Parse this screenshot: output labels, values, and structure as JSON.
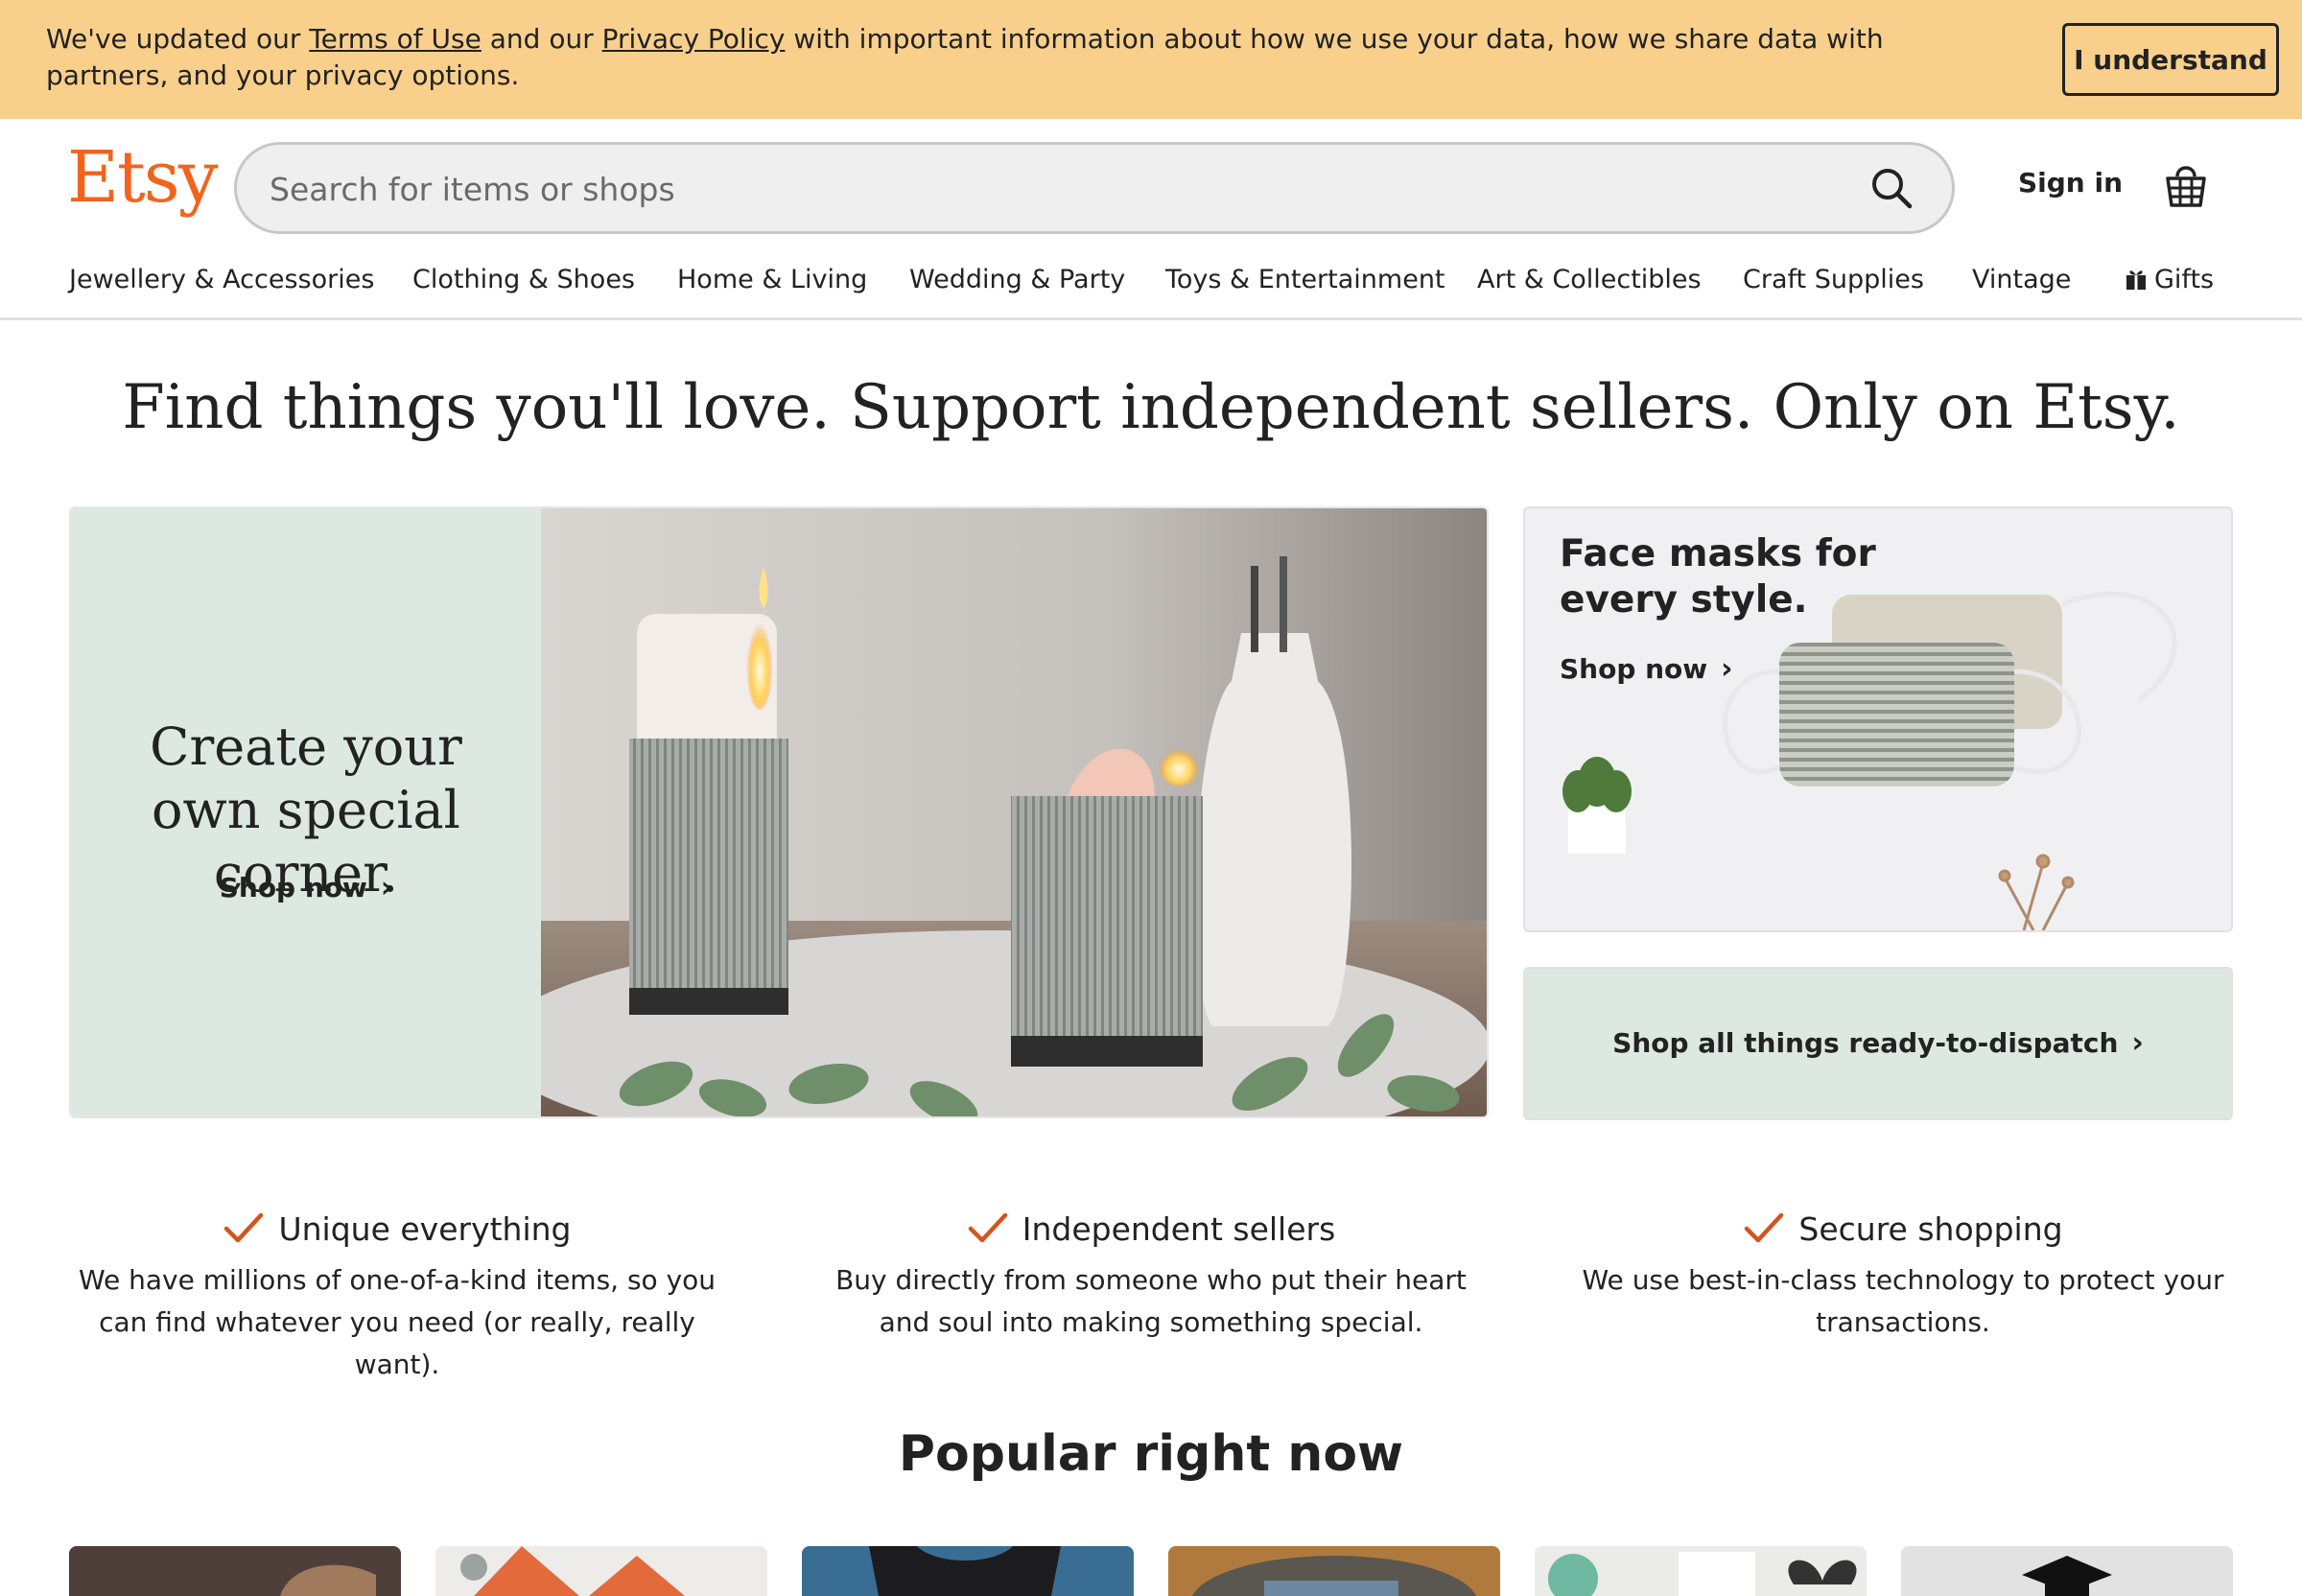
{
  "banner": {
    "text_before": "We've updated our ",
    "terms_link": "Terms of Use",
    "text_middle": " and our ",
    "privacy_link": "Privacy Policy",
    "text_after": " with important information about how we use your data, how we share data with partners, and your privacy options.",
    "button_label": "I understand"
  },
  "header": {
    "logo": "Etsy",
    "search_placeholder": "Search for items or shops",
    "sign_in": "Sign in",
    "icons": [
      "search-icon",
      "shopping-basket-icon"
    ]
  },
  "nav": {
    "items": [
      "Jewellery & Accessories",
      "Clothing & Shoes",
      "Home & Living",
      "Wedding & Party",
      "Toys & Entertainment",
      "Art & Collectibles",
      "Craft Supplies",
      "Vintage",
      "Gifts"
    ]
  },
  "headline": "Find things you'll love. Support independent sellers. Only on Etsy.",
  "hero": {
    "title": "Create your own special corner.",
    "cta": "Shop now"
  },
  "mask_card": {
    "title": "Face masks for every style.",
    "cta": "Shop now"
  },
  "dispatch_card": {
    "label": "Shop all things ready-to-dispatch"
  },
  "value_props": [
    {
      "title": "Unique everything",
      "description": "We have millions of one-of-a-kind items, so you can find whatever you need (or really, really want)."
    },
    {
      "title": "Independent sellers",
      "description": "Buy directly from someone who put their heart and soul into making something special."
    },
    {
      "title": "Secure shopping",
      "description": "We use best-in-class technology to protect your transactions."
    }
  ],
  "popular": {
    "title": "Popular right now"
  },
  "colors": {
    "brand": "#f1641e",
    "banner_bg": "#f8d08c",
    "mint_panel": "#dde8e1",
    "check": "#d5541b"
  }
}
